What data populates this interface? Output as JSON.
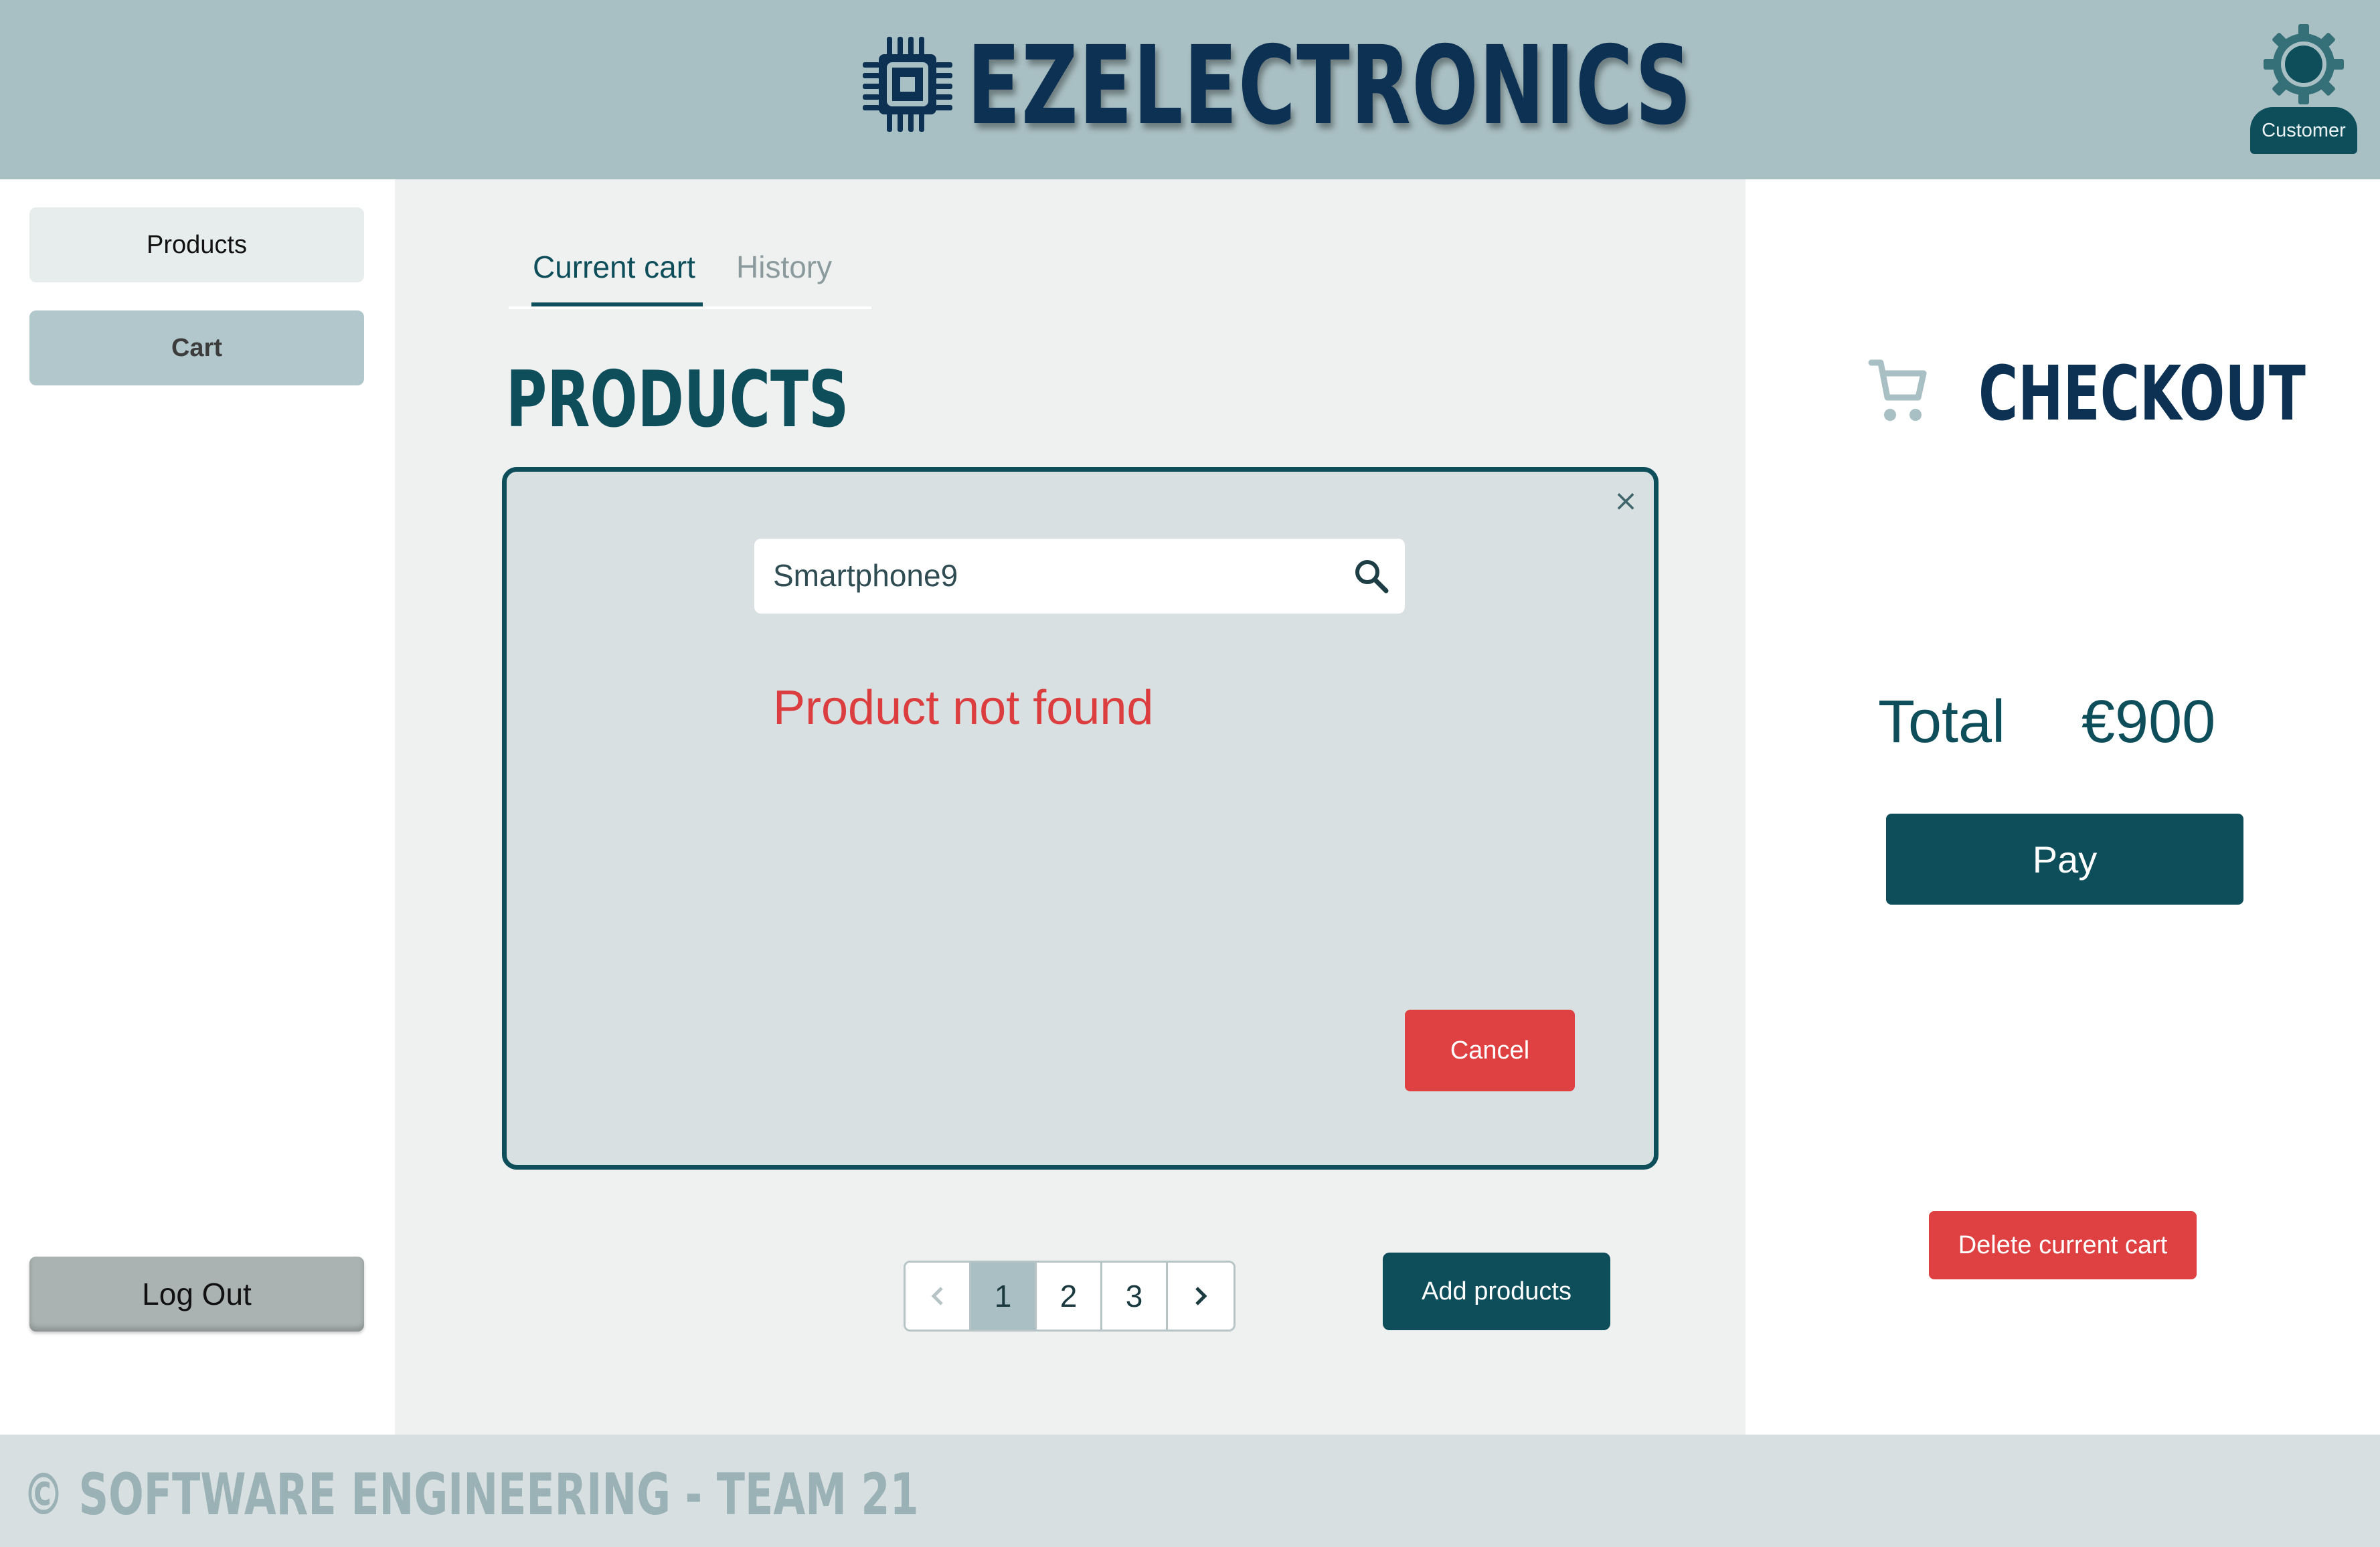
{
  "header": {
    "brand": "EZELECTRONICS",
    "user_role": "Customer",
    "icons": {
      "logo": "chip-icon",
      "user": "gear-avatar-icon"
    }
  },
  "sidebar": {
    "items": [
      {
        "label": "Products"
      },
      {
        "label": "Cart"
      }
    ],
    "logout_label": "Log Out"
  },
  "main": {
    "tabs": [
      {
        "label": "Current cart",
        "active": true
      },
      {
        "label": "History",
        "active": false
      }
    ],
    "title": "PRODUCTS",
    "modal": {
      "search_value": "Smartphone9",
      "message": "Product not found",
      "cancel_label": "Cancel",
      "close_glyph": "×"
    },
    "pagination": {
      "pages": [
        "1",
        "2",
        "3"
      ],
      "current": "1"
    },
    "add_label": "Add products"
  },
  "checkout": {
    "title": "CHECKOUT",
    "total_label": "Total",
    "total_value": "€900",
    "pay_label": "Pay",
    "delete_label": "Delete current cart"
  },
  "footer": {
    "text": "© SOFTWARE ENGINEERING - TEAM 21"
  },
  "colors": {
    "header_bg": "#a8bfc3",
    "primary": "#0d4e5a",
    "navy": "#0d3152",
    "danger": "#df4143",
    "page_bg": "#eff0f0"
  }
}
